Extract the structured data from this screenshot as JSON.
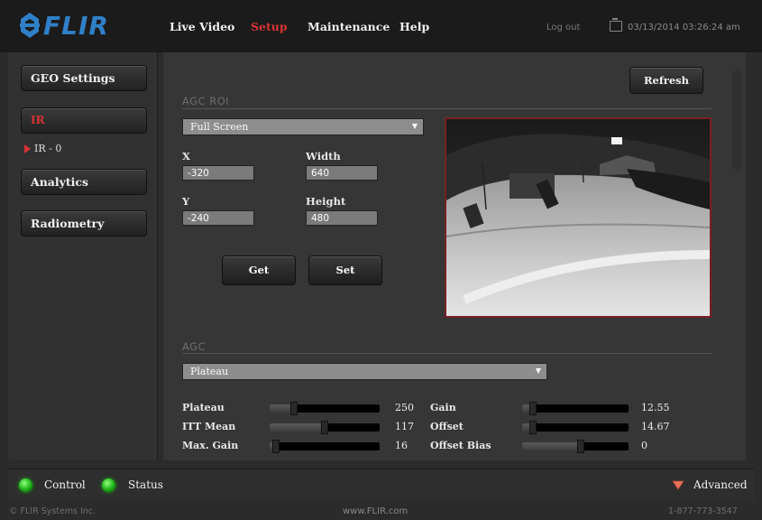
{
  "header": {
    "logo_text": "FLIR",
    "nav": [
      "Live Video",
      "Setup",
      "Maintenance",
      "Help"
    ],
    "active_nav": "Setup",
    "logout_label": "Log out",
    "datetime": "03/13/2014 03:26:24 am",
    "brand_color": "#2f80c8",
    "active_color": "#d63434"
  },
  "sidebar": {
    "items": [
      {
        "label": "GEO Settings"
      },
      {
        "label": "IR"
      },
      {
        "label": "Analytics"
      },
      {
        "label": "Radiometry"
      }
    ],
    "sub_item_label": "IR - 0"
  },
  "main": {
    "refresh_label": "Refresh",
    "agc_roi": {
      "title": "AGC ROI",
      "mode": "Full Screen",
      "x_label": "X",
      "x_value": "-320",
      "width_label": "Width",
      "width_value": "640",
      "y_label": "Y",
      "y_value": "-240",
      "height_label": "Height",
      "height_value": "480",
      "get_label": "Get",
      "set_label": "Set"
    },
    "agc": {
      "title": "AGC",
      "mode": "Plateau",
      "left_sliders": [
        {
          "label": "Plateau",
          "value": "250",
          "level": 0.22
        },
        {
          "label": "ITT Mean",
          "value": "117",
          "level": 0.5
        },
        {
          "label": "Max. Gain",
          "value": "16",
          "level": 0.06
        }
      ],
      "right_sliders": [
        {
          "label": "Gain",
          "value": "12.55",
          "level": 0.1
        },
        {
          "label": "Offset",
          "value": "14.67",
          "level": 0.1
        },
        {
          "label": "Offset Bias",
          "value": "0",
          "level": 0.55
        }
      ]
    }
  },
  "footer": {
    "control_label": "Control",
    "status_label": "Status",
    "advanced_label": "Advanced",
    "copyright": "© FLIR Systems Inc.",
    "website": "www.FLIR.com",
    "phone": "1-877-773-3547",
    "status_color": "#1cae16"
  }
}
